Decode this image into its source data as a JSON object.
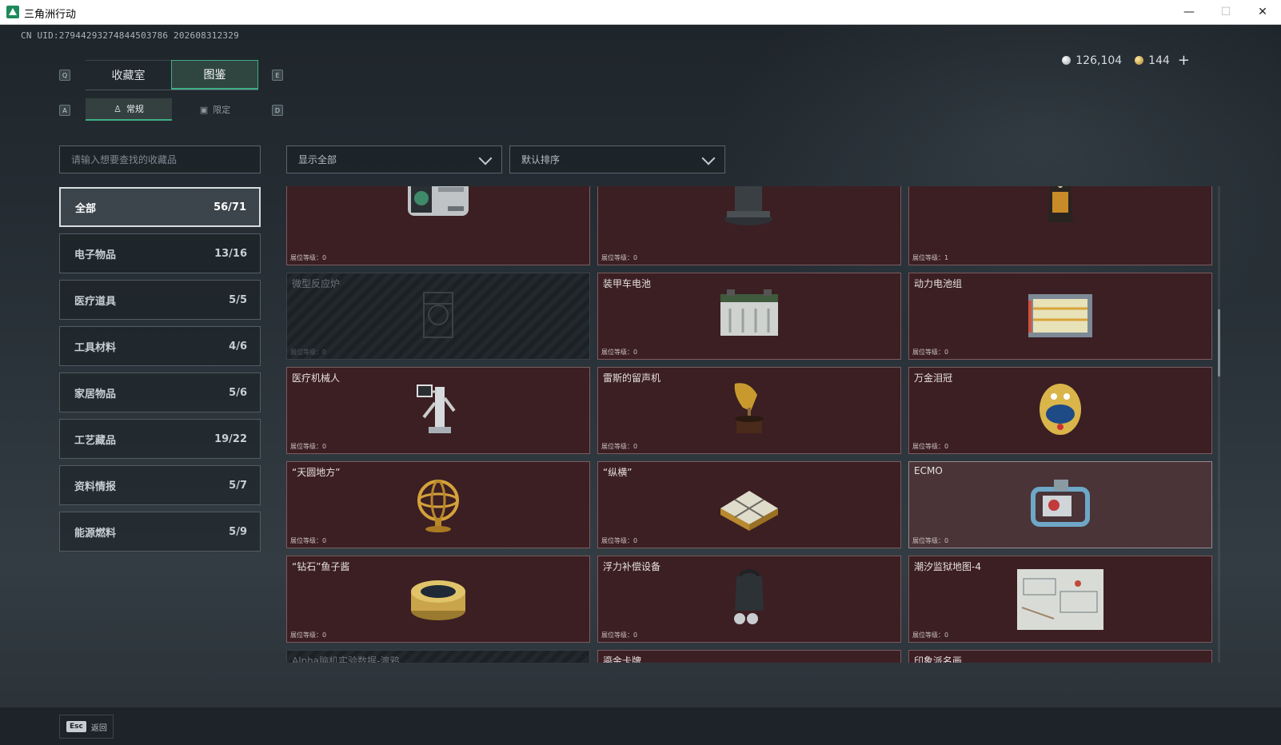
{
  "window": {
    "title": "三角洲行动",
    "controls": {
      "minimize": "—",
      "maximize": "☐",
      "close": "✕"
    }
  },
  "header": {
    "uid": "CN UID:27944293274844503786 202608312329",
    "silver": "126,104",
    "gold": "144",
    "add": "+"
  },
  "keys": {
    "prev_tab": "Q",
    "next_tab": "E",
    "prev_sub": "A",
    "next_sub": "D"
  },
  "tabs": [
    {
      "label": "收藏室"
    },
    {
      "label": "图鉴"
    }
  ],
  "subtabs": [
    {
      "label": "常规",
      "icon": "trophy-icon"
    },
    {
      "label": "限定",
      "icon": "image-icon"
    }
  ],
  "search": {
    "placeholder": "请输入想要查找的收藏品"
  },
  "filters": {
    "show": "显示全部",
    "sort": "默认排序"
  },
  "categories": [
    {
      "label": "全部",
      "count": "56/71"
    },
    {
      "label": "电子物品",
      "count": "13/16"
    },
    {
      "label": "医疗道具",
      "count": "5/5"
    },
    {
      "label": "工具材料",
      "count": "4/6"
    },
    {
      "label": "家居物品",
      "count": "5/6"
    },
    {
      "label": "工艺藏品",
      "count": "19/22"
    },
    {
      "label": "资料情报",
      "count": "5/7"
    },
    {
      "label": "能源燃料",
      "count": "5/9"
    }
  ],
  "items": [
    {
      "name": "",
      "level": "展位等级：0",
      "icon": "camera-rig-icon"
    },
    {
      "name": "",
      "level": "展位等级：0",
      "icon": "robot-vacuum-icon"
    },
    {
      "name": "",
      "level": "展位等级：1",
      "icon": "coffee-bag-icon"
    },
    {
      "name": "微型反应炉",
      "level": "展位等级：0",
      "icon": "reactor-icon"
    },
    {
      "name": "装甲车电池",
      "level": "展位等级：0",
      "icon": "battery-icon"
    },
    {
      "name": "动力电池组",
      "level": "展位等级：0",
      "icon": "battery-pack-icon"
    },
    {
      "name": "医疗机械人",
      "level": "展位等级：0",
      "icon": "medical-robot-icon"
    },
    {
      "name": "雷斯的留声机",
      "level": "展位等级：0",
      "icon": "gramophone-icon"
    },
    {
      "name": "万金泪冠",
      "level": "展位等级：0",
      "icon": "jeweled-egg-icon"
    },
    {
      "name": "“天圆地方”",
      "level": "展位等级：0",
      "icon": "armillary-sphere-icon"
    },
    {
      "name": "“纵横”",
      "level": "展位等级：0",
      "icon": "chessboard-icon"
    },
    {
      "name": "ECMO",
      "level": "展位等级：0",
      "icon": "ecmo-machine-icon"
    },
    {
      "name": "“钻石”鱼子酱",
      "level": "展位等级：0",
      "icon": "caviar-tin-icon"
    },
    {
      "name": "浮力补偿设备",
      "level": "展位等级：0",
      "icon": "diving-gear-icon"
    },
    {
      "name": "潮汐监狱地图-4",
      "level": "展位等级：0",
      "icon": "map-icon"
    },
    {
      "name": "Alpha脑机实验数据-渡鸦",
      "level": "",
      "icon": "data-drive-icon"
    },
    {
      "name": "鎏金卡牌",
      "level": "",
      "icon": "gold-card-icon"
    },
    {
      "name": "印象派名画",
      "level": "",
      "icon": "painting-icon"
    }
  ],
  "footer": {
    "esc_key": "Esc",
    "esc_label": "返回"
  },
  "colors": {
    "accent": "#3fae84",
    "card_bg": "#3c1f23",
    "card_border": "#7b5b5e"
  }
}
